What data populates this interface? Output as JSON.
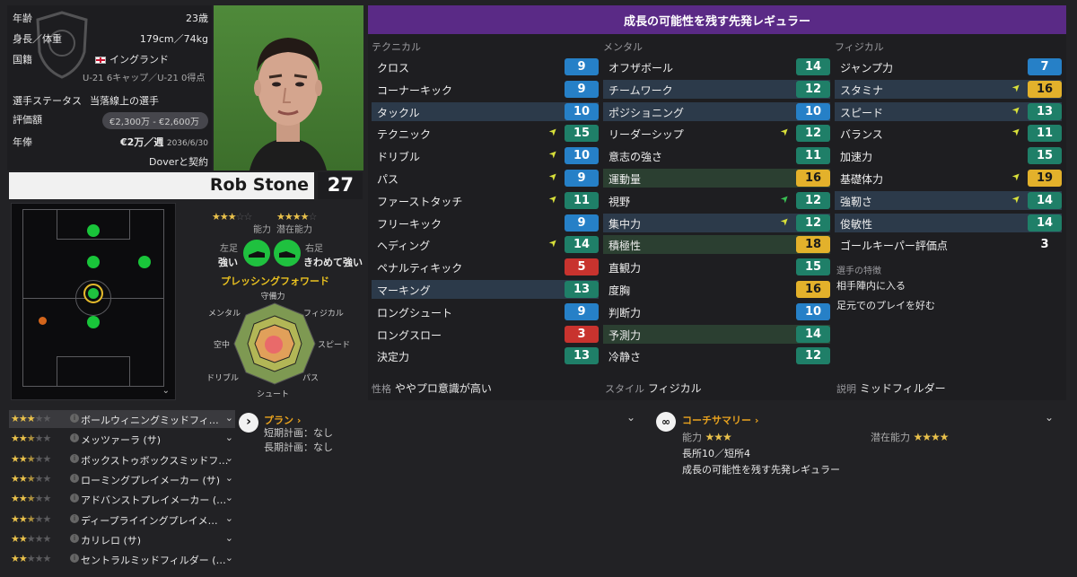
{
  "info": {
    "age_label": "年齢",
    "age": "23歳",
    "height_label": "身長／体重",
    "height": "179cm／74kg",
    "nation_label": "国籍",
    "nation": "イングランド",
    "caps": "U-21 6キャップ／U-21 0得点",
    "status_label": "選手ステータス",
    "status": "当落線上の選手",
    "value_label": "評価額",
    "value": "€2,300万 - €2,600万",
    "wage_label": "年俸",
    "wage": "€2万／週",
    "wage_until": "2036/6/30",
    "contract": "Doverと契約"
  },
  "player": {
    "name": "Rob Stone",
    "number": "27"
  },
  "ability": {
    "ca_label": "能力",
    "pa_label": "潜在能力",
    "left_foot_label": "左足",
    "left_foot": "強い",
    "right_foot_label": "右足",
    "right_foot": "きわめて強い",
    "role": "プレッシングフォワード",
    "radar_labels": [
      "守備力",
      "フィジカル",
      "スピード",
      "パス",
      "シュート",
      "ドリブル",
      "空中",
      "メンタル"
    ]
  },
  "attributes": {
    "header": "成長の可能性を残す先発レギュラー",
    "technical_label": "テクニカル",
    "mental_label": "メンタル",
    "physical_label": "フィジカル",
    "technical": [
      {
        "name": "クロス",
        "value": "9",
        "color": "blue",
        "arrow": ""
      },
      {
        "name": "コーナーキック",
        "value": "9",
        "color": "blue",
        "arrow": ""
      },
      {
        "name": "タックル",
        "value": "10",
        "color": "blue",
        "arrow": "",
        "hl": true
      },
      {
        "name": "テクニック",
        "value": "15",
        "color": "teal",
        "arrow": "y"
      },
      {
        "name": "ドリブル",
        "value": "10",
        "color": "blue",
        "arrow": "y"
      },
      {
        "name": "パス",
        "value": "9",
        "color": "blue",
        "arrow": "y"
      },
      {
        "name": "ファーストタッチ",
        "value": "11",
        "color": "teal",
        "arrow": "y"
      },
      {
        "name": "フリーキック",
        "value": "9",
        "color": "blue",
        "arrow": ""
      },
      {
        "name": "ヘディング",
        "value": "14",
        "color": "teal",
        "arrow": "y"
      },
      {
        "name": "ペナルティキック",
        "value": "5",
        "color": "red",
        "arrow": ""
      },
      {
        "name": "マーキング",
        "value": "13",
        "color": "teal",
        "arrow": "",
        "hl": true
      },
      {
        "name": "ロングシュート",
        "value": "9",
        "color": "blue",
        "arrow": ""
      },
      {
        "name": "ロングスロー",
        "value": "3",
        "color": "red",
        "arrow": ""
      },
      {
        "name": "決定力",
        "value": "13",
        "color": "teal",
        "arrow": ""
      }
    ],
    "mental": [
      {
        "name": "オフザボール",
        "value": "14",
        "color": "teal",
        "arrow": ""
      },
      {
        "name": "チームワーク",
        "value": "12",
        "color": "teal",
        "arrow": "",
        "hl": true
      },
      {
        "name": "ポジショニング",
        "value": "10",
        "color": "blue",
        "arrow": "",
        "hl": true
      },
      {
        "name": "リーダーシップ",
        "value": "12",
        "color": "teal",
        "arrow": "y"
      },
      {
        "name": "意志の強さ",
        "value": "11",
        "color": "teal",
        "arrow": ""
      },
      {
        "name": "運動量",
        "value": "16",
        "color": "yel",
        "arrow": "",
        "hl": true
      },
      {
        "name": "視野",
        "value": "12",
        "color": "teal",
        "arrow": "g"
      },
      {
        "name": "集中力",
        "value": "12",
        "color": "teal",
        "arrow": "y",
        "hl": true
      },
      {
        "name": "積極性",
        "value": "18",
        "color": "yel",
        "arrow": "",
        "hl": true
      },
      {
        "name": "直観力",
        "value": "15",
        "color": "teal",
        "arrow": ""
      },
      {
        "name": "度胸",
        "value": "16",
        "color": "yel",
        "arrow": ""
      },
      {
        "name": "判断力",
        "value": "10",
        "color": "blue",
        "arrow": ""
      },
      {
        "name": "予測力",
        "value": "14",
        "color": "teal",
        "arrow": "",
        "hl": true
      },
      {
        "name": "冷静さ",
        "value": "12",
        "color": "teal",
        "arrow": ""
      }
    ],
    "physical": [
      {
        "name": "ジャンプ力",
        "value": "7",
        "color": "blue",
        "arrow": ""
      },
      {
        "name": "スタミナ",
        "value": "16",
        "color": "yel",
        "arrow": "y",
        "hl": true
      },
      {
        "name": "スピード",
        "value": "13",
        "color": "teal",
        "arrow": "y",
        "hl": true
      },
      {
        "name": "バランス",
        "value": "11",
        "color": "teal",
        "arrow": "y"
      },
      {
        "name": "加速力",
        "value": "15",
        "color": "teal",
        "arrow": ""
      },
      {
        "name": "基礎体力",
        "value": "19",
        "color": "yel",
        "arrow": "y"
      },
      {
        "name": "強靭さ",
        "value": "14",
        "color": "teal",
        "arrow": "y",
        "hl": true
      },
      {
        "name": "俊敏性",
        "value": "14",
        "color": "teal",
        "arrow": "",
        "hl": true
      },
      {
        "name": "ゴールキーパー評価点",
        "value": "3",
        "color": "none",
        "arrow": ""
      }
    ],
    "traits_label": "選手の特徴",
    "traits": [
      "相手陣内に入る",
      "足元でのプレイを好む"
    ],
    "personality_label": "性格",
    "personality": "ややプロ意識が高い",
    "style_label": "スタイル",
    "style": "フィジカル",
    "desc_label": "説明",
    "desc": "ミッドフィルダー"
  },
  "roles": [
    {
      "stars": 3,
      "name": "ボールウィニングミッドフィ…"
    },
    {
      "stars": 2.5,
      "name": "メッツァーラ (サ)"
    },
    {
      "stars": 2.5,
      "name": "ボックストゥボックスミッドフ…"
    },
    {
      "stars": 2.5,
      "name": "ローミングプレイメーカー (サ)"
    },
    {
      "stars": 2.5,
      "name": "アドバンストプレイメーカー (…"
    },
    {
      "stars": 2.5,
      "name": "ディープライイングプレイメ…"
    },
    {
      "stars": 2,
      "name": "カリレロ (サ)"
    },
    {
      "stars": 2,
      "name": "セントラルミッドフィルダー (…"
    }
  ],
  "plan": {
    "title": "プラン",
    "short": "短期計画：なし",
    "long": "長期計画：なし"
  },
  "coach": {
    "title": "コーチサマリー",
    "ca_label": "能力",
    "pa_label": "潜在能力",
    "strengths": "長所10／短所4",
    "summary": "成長の可能性を残す先発レギュラー"
  },
  "colors": {
    "header": "#5a2a86",
    "blue": "#2680c7",
    "teal": "#1f7f68",
    "yellow": "#e3b12b",
    "red": "#c8332e"
  }
}
